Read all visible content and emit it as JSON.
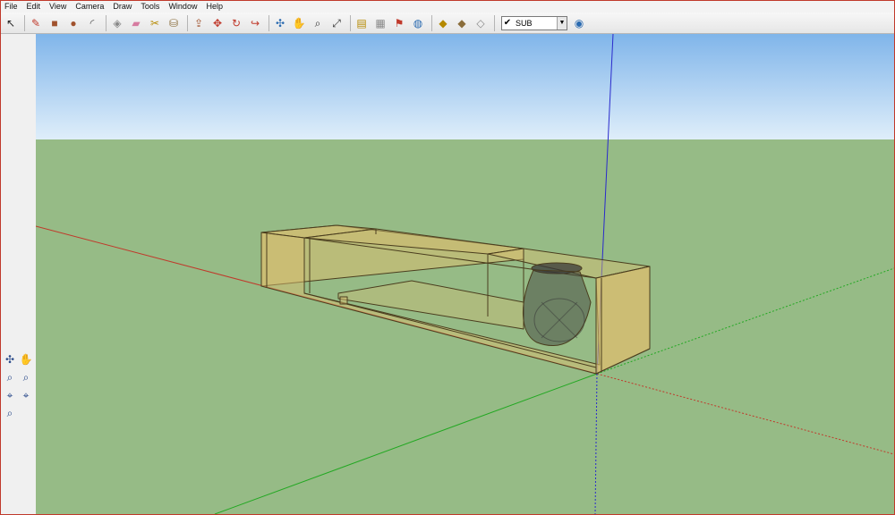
{
  "menu": [
    "File",
    "Edit",
    "View",
    "Camera",
    "Draw",
    "Tools",
    "Window",
    "Help"
  ],
  "toolbar": {
    "tools": [
      {
        "name": "select-tool-icon",
        "glyph": "↖",
        "color": "#222"
      },
      {
        "sep": true
      },
      {
        "name": "line-tool-icon",
        "glyph": "✎",
        "color": "#c0392b"
      },
      {
        "name": "rectangle-tool-icon",
        "glyph": "■",
        "color": "#a0522d"
      },
      {
        "name": "circle-tool-icon",
        "glyph": "●",
        "color": "#a0522d"
      },
      {
        "name": "arc-tool-icon",
        "glyph": "◜",
        "color": "#555"
      },
      {
        "sep": true
      },
      {
        "name": "make-component-icon",
        "glyph": "◈",
        "color": "#888"
      },
      {
        "name": "eraser-tool-icon",
        "glyph": "▰",
        "color": "#d67ba0"
      },
      {
        "name": "tape-measure-icon",
        "glyph": "✂",
        "color": "#b58900"
      },
      {
        "name": "paint-bucket-icon",
        "glyph": "⛁",
        "color": "#8a6d3b"
      },
      {
        "sep": true
      },
      {
        "name": "push-pull-icon",
        "glyph": "⇪",
        "color": "#a0522d"
      },
      {
        "name": "move-tool-icon",
        "glyph": "✥",
        "color": "#c0392b"
      },
      {
        "name": "rotate-tool-icon",
        "glyph": "↻",
        "color": "#c0392b"
      },
      {
        "name": "offset-tool-icon",
        "glyph": "↪",
        "color": "#c0392b"
      },
      {
        "sep": true
      },
      {
        "name": "orbit-tool-icon",
        "glyph": "✣",
        "color": "#2a6ab0"
      },
      {
        "name": "pan-tool-icon",
        "glyph": "✋",
        "color": "#555"
      },
      {
        "name": "zoom-tool-icon",
        "glyph": "⌕",
        "color": "#333"
      },
      {
        "name": "zoom-extents-icon",
        "glyph": "⤢",
        "color": "#333"
      },
      {
        "sep": true
      },
      {
        "name": "get-current-view-icon",
        "glyph": "▤",
        "color": "#b58900"
      },
      {
        "name": "toggle-terrain-icon",
        "glyph": "▦",
        "color": "#888"
      },
      {
        "name": "add-location-icon",
        "glyph": "⚑",
        "color": "#c0392b"
      },
      {
        "name": "preview-model-icon",
        "glyph": "◍",
        "color": "#2a6ab0"
      },
      {
        "sep": true
      },
      {
        "name": "get-models-icon",
        "glyph": "◆",
        "color": "#b58900"
      },
      {
        "name": "share-model-icon",
        "glyph": "◆",
        "color": "#8a6d3b"
      },
      {
        "name": "share-component-icon",
        "glyph": "◇",
        "color": "#888"
      }
    ],
    "layer": {
      "check": "✔",
      "name": "SUB",
      "arrow": "▼"
    },
    "layer_manager_glyph": "◉"
  },
  "sidebar": [
    {
      "name": "orbit-icon",
      "glyph": "✣"
    },
    {
      "name": "pan-icon",
      "glyph": "✋"
    },
    {
      "name": "zoom-icon",
      "glyph": "⌕"
    },
    {
      "name": "zoom-window-icon",
      "glyph": "⌕"
    },
    {
      "name": "previous-view-icon",
      "glyph": "⌖"
    },
    {
      "name": "zoom-extents-icon",
      "glyph": "⌖"
    },
    {
      "name": "zoom-window-small-icon",
      "glyph": "⌕"
    }
  ],
  "colors": {
    "sky_top": "#80b5ea",
    "sky_horizon": "#dfeefa",
    "ground": "#96bb86",
    "red_axis": "#c0392b",
    "green_axis": "#22a822",
    "blue_axis": "#2a2acc",
    "box_fill": "#d9be70"
  }
}
